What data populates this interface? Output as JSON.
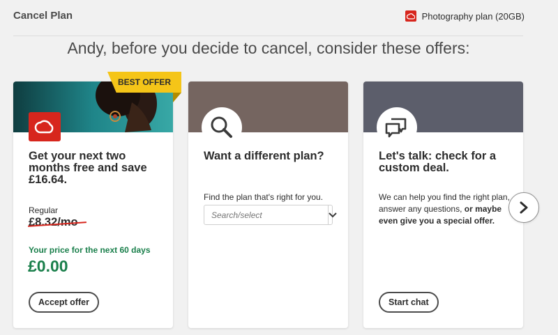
{
  "header": {
    "title": "Cancel Plan",
    "plan_label": "Photography plan (20GB)"
  },
  "headline": "Andy, before you decide to cancel, consider these offers:",
  "cards": [
    {
      "badge": "BEST OFFER",
      "title_line1": "Get your next two",
      "title_line2": "months free and save",
      "title_line3": "£16.64.",
      "regular_label": "Regular",
      "regular_price": "£8.32/mo",
      "promo_label": "Your price for the next 60 days",
      "promo_price": "£0.00",
      "button": "Accept offer",
      "banner_color": "#1e7e82"
    },
    {
      "title": "Want a different plan?",
      "prompt": "Find the plan that's right for you.",
      "select_placeholder": "Search/select",
      "icon": "search-icon",
      "banner_color": "#756560"
    },
    {
      "title_line1": "Let's talk: check for a",
      "title_line2": "custom deal.",
      "text_line1": "We can help you find the right plan,",
      "text_line2a": "answer any questions, ",
      "text_line2b": "or maybe",
      "text_line3": "even give you a special offer.",
      "button": "Start chat",
      "icon": "chat-bubbles-icon",
      "banner_color": "#5c5e6b"
    }
  ],
  "colors": {
    "accent_green": "#1a7f4b",
    "badge_yellow": "#f5c518",
    "brand_red": "#d7261d"
  }
}
